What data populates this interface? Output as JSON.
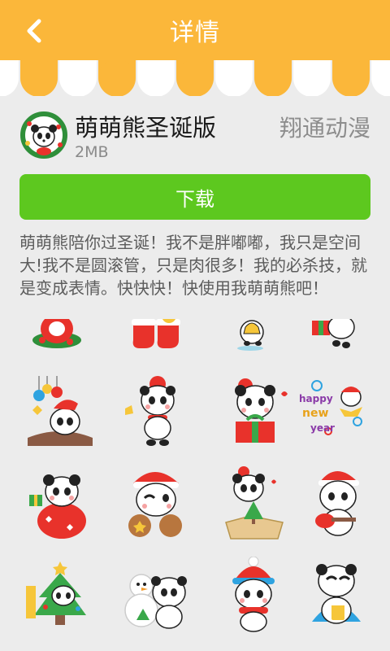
{
  "header": {
    "title": "详情",
    "back_icon": "chevron-left-icon"
  },
  "app": {
    "name": "萌萌熊圣诞版",
    "size": "2MB",
    "developer": "翔通动漫",
    "icon": "panda-wreath-icon"
  },
  "download_label": "下载",
  "description": "萌萌熊陪你过圣诞！我不是胖嘟嘟，我只是空间大!我不是圆滚管，只是肉很多！我的必杀技，就是变成表情。快快快！快使用我萌萌熊吧！",
  "stickers_text": {
    "happy_new_year": "happy new year"
  },
  "colors": {
    "header": "#fbb73a",
    "download_button": "#5dc81f",
    "background": "#ececec",
    "santa_red": "#e8322b",
    "tree_green": "#3aa84a"
  }
}
